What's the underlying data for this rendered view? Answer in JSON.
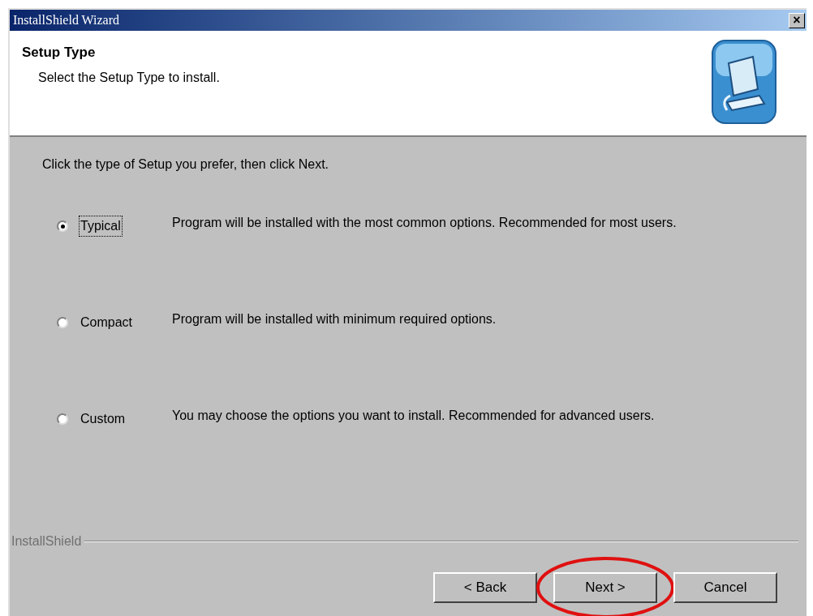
{
  "window": {
    "title": "InstallShield Wizard",
    "close": "×"
  },
  "header": {
    "title": "Setup Type",
    "subtitle": "Select the Setup Type to install."
  },
  "intro": "Click the type of Setup you prefer, then click Next.",
  "options": [
    {
      "label": "Typical",
      "description": "Program will be installed with the most common options.  Recommended for most users.",
      "selected": true
    },
    {
      "label": "Compact",
      "description": "Program will be installed with minimum required options.",
      "selected": false
    },
    {
      "label": "Custom",
      "description": "You may choose the options you want to install. Recommended for advanced users.",
      "selected": false
    }
  ],
  "footer": {
    "brand": "InstallShield"
  },
  "buttons": [
    {
      "label": "< Back",
      "highlighted": false
    },
    {
      "label": "Next >",
      "highlighted": true
    },
    {
      "label": "Cancel",
      "highlighted": false
    }
  ]
}
